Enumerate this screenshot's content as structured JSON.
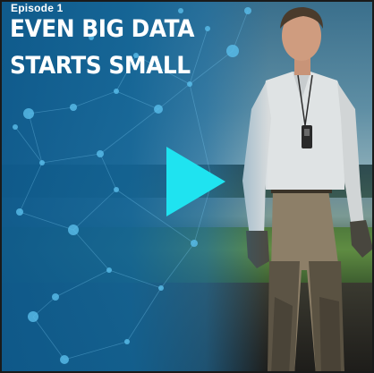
{
  "video": {
    "episode_label": "Episode 1",
    "title_line_1": "EVEN BIG DATA",
    "title_line_2": "STARTS SMALL"
  },
  "colors": {
    "play_accent": "#1fe3f0",
    "network_blue": "#1767a0",
    "title_text": "#ffffff"
  },
  "icons": {
    "play": "play-icon"
  }
}
